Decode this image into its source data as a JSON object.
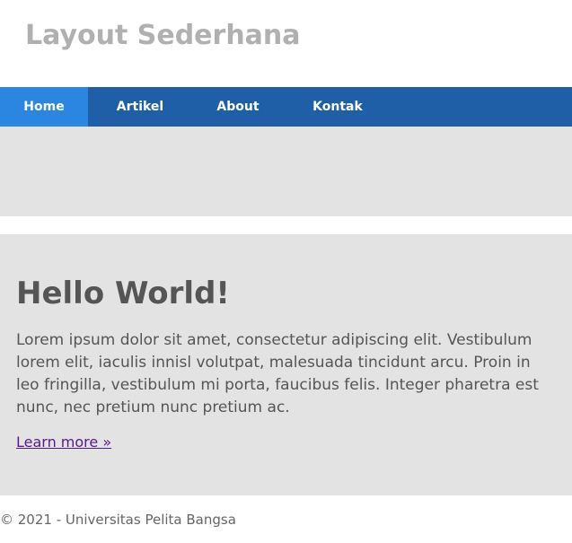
{
  "header": {
    "title": "Layout Sederhana"
  },
  "nav": {
    "items": [
      {
        "label": "Home",
        "active": true
      },
      {
        "label": "Artikel",
        "active": false
      },
      {
        "label": "About",
        "active": false
      },
      {
        "label": "Kontak",
        "active": false
      }
    ]
  },
  "hero": {
    "title": "Hello World!",
    "text": "Lorem ipsum dolor sit amet, consectetur adipiscing elit. Vestibulum lorem elit, iaculis innisl volutpat, malesuada tincidunt arcu. Proin in leo fringilla, vestibulum mi porta, faucibus felis. Integer pharetra est nunc, nec pretium nunc pretium ac.",
    "link_label": "Learn more »"
  },
  "footer": {
    "text": "© 2021 - Universitas Pelita Bangsa"
  },
  "colors": {
    "nav_background": "#1f5fa8",
    "nav_active": "#2a86e0",
    "panel_background": "#e3e3e3",
    "title_gray": "#b0b0b0",
    "body_text": "#555555",
    "link_visited": "#551a8b"
  }
}
